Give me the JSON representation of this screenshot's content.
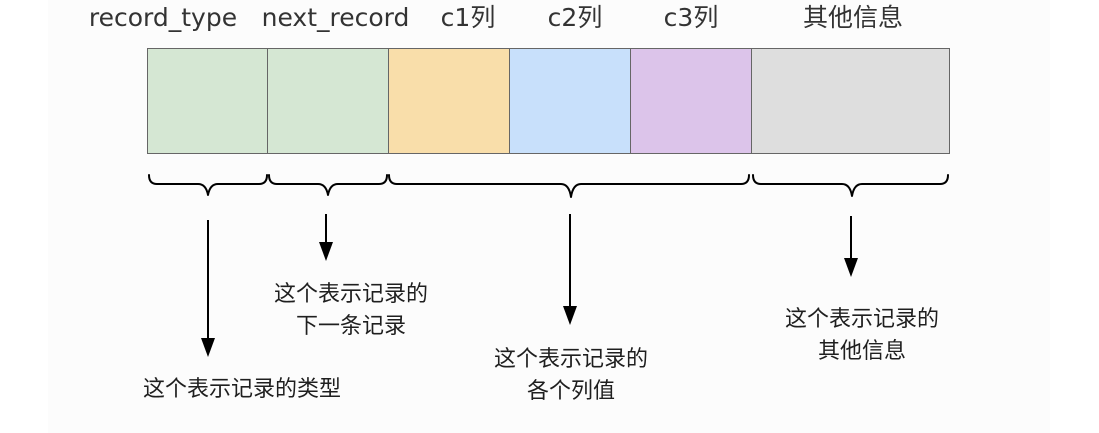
{
  "headers": {
    "record_type": "record_type",
    "next_record": "next_record",
    "c1": "c1列",
    "c2": "c2列",
    "c3": "c3列",
    "other": "其他信息"
  },
  "colors": {
    "record_type": "#d5e7d3",
    "next_record": "#d5e7d3",
    "c1": "#f9deaa",
    "c2": "#c8e0fb",
    "c3": "#dcc4ea",
    "other": "#dedede"
  },
  "notes": {
    "record_type": "这个表示记录的类型",
    "next_record": "这个表示记录的\n下一条记录",
    "columns": "这个表示记录的\n各个列值",
    "other": "这个表示记录的\n其他信息"
  }
}
